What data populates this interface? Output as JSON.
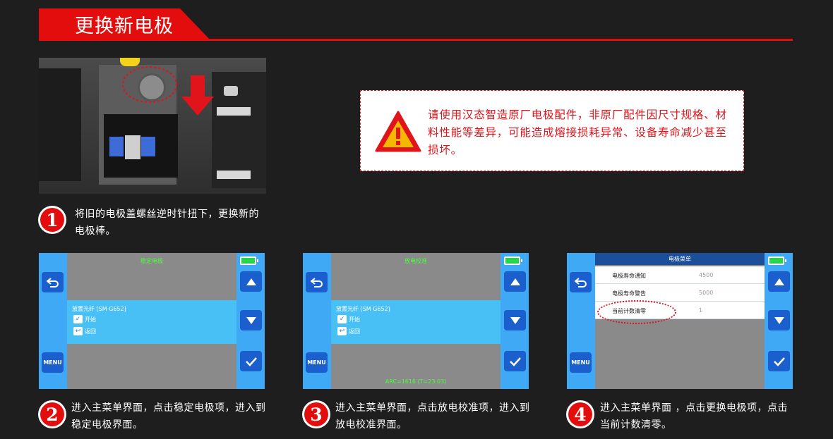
{
  "header": {
    "title": "更换新电极"
  },
  "warning": {
    "text": "请使用汉态智造原厂电极配件，非原厂配件因尺寸规格、材料性能等差异，可能造成熔接损耗异常、设备寿命减少甚至损坏。"
  },
  "steps": [
    {
      "num": "1",
      "text": "将旧的电极盖螺丝逆时针扭下，更换新的电极棒。"
    },
    {
      "num": "2",
      "text": "进入主菜单界面，点击稳定电极项，进入到稳定电极界面。"
    },
    {
      "num": "3",
      "text": "进入主菜单界面，点击放电校准项，进入到放电校准界面。"
    },
    {
      "num": "4",
      "text": "进入主菜单界面 ，点击更换电极项，点击当前计数清零。"
    }
  ],
  "screen2": {
    "title": "稳定电极",
    "panel_header": "放置光纤 [SM G652]",
    "opt_start": "开始",
    "opt_back": "返回",
    "menu_label": "MENU"
  },
  "screen3": {
    "title": "放电校准",
    "panel_header": "放置光纤 [SM G652]",
    "opt_start": "开始",
    "opt_back": "返回",
    "menu_label": "MENU",
    "footer": "ARC=1616 (T=23.03)"
  },
  "screen4": {
    "title": "电极菜单",
    "menu_label": "MENU",
    "rows": [
      {
        "label": "电极寿命通知",
        "value": "4500"
      },
      {
        "label": "电极寿命警告",
        "value": "5000"
      },
      {
        "label": "当前计数清零",
        "value": "1"
      }
    ]
  },
  "colors": {
    "accent": "#e30d0d",
    "screen_blue": "#3fa9f5",
    "button_blue": "#1b5fcf"
  }
}
